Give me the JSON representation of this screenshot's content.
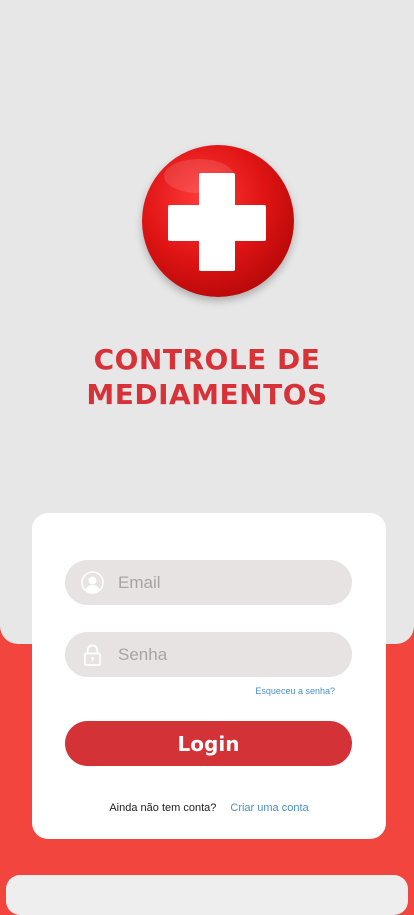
{
  "app": {
    "title_line1": "CONTROLE DE",
    "title_line2": "MEDIAMENTOS"
  },
  "login": {
    "email_placeholder": "Email",
    "password_placeholder": "Senha",
    "forgot_password": "Esqueceu a senha?",
    "login_label": "Login",
    "no_account_text": "Ainda não tem conta?",
    "create_account_link": "Criar uma conta"
  },
  "icons": {
    "logo": "red-cross-icon",
    "email": "user-icon",
    "password": "lock-icon"
  },
  "colors": {
    "accent_red": "#d33237",
    "background_red": "#f2453d",
    "panel_gray": "#e7e7e7",
    "input_gray": "#e6e3e2",
    "link_blue": "#4a8fc7"
  }
}
